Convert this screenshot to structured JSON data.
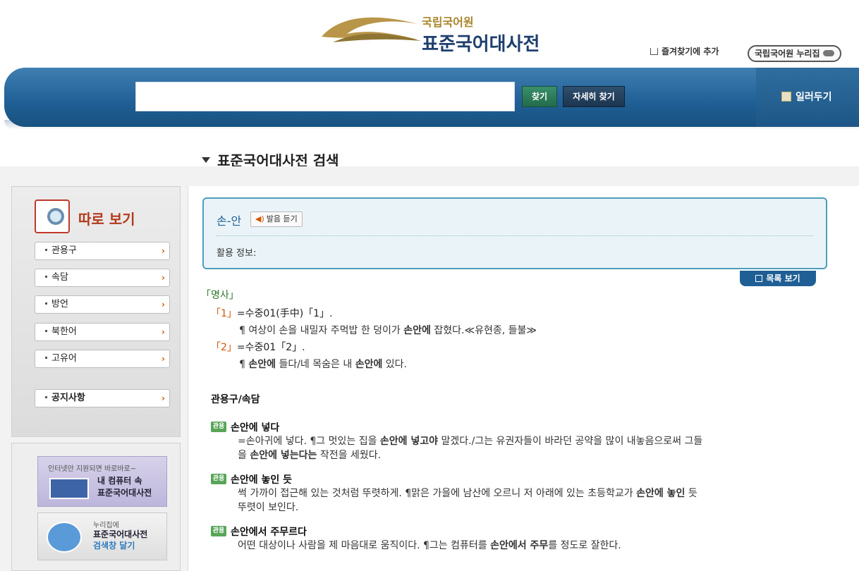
{
  "header": {
    "logo_small": "국립국어원",
    "logo_big": "표준국어대사전",
    "favorite_label": "즐겨찾기에 추가",
    "nuri_label": "국립국어원 누리집"
  },
  "search": {
    "input_value": "",
    "find_label": "찾기",
    "advanced_label": "자세히 찾기",
    "notice_label": "일러두기"
  },
  "page_title": "표준국어대사전 검색",
  "sidebar": {
    "heading": "따로 보기",
    "items": [
      {
        "label": "관용구"
      },
      {
        "label": "속담"
      },
      {
        "label": "방언"
      },
      {
        "label": "북한어"
      },
      {
        "label": "고유어"
      }
    ],
    "notice": "공지사항",
    "arrow": "›"
  },
  "promo": {
    "p1_small": "인터넷만 지원되면 바로바로~",
    "p1_line1": "내 컴퓨터 속",
    "p1_line2": "표준국어대사전",
    "p2_small": "누리집에",
    "p2_line1": "표준국어대사전",
    "p2_line2": "검색창 달기"
  },
  "entry": {
    "word": "손-안",
    "pron_label": "발음 듣기",
    "usage_label": "활용 정보:",
    "list_label": "목록 보기",
    "pos": "「명사」",
    "senses": [
      {
        "num": "「1」",
        "text": "=수중01(手中)「1」.",
        "example_pre": "¶ 여상이 손을 내밀자 주먹밥 한 덩이가 ",
        "example_bold": "손안에",
        "example_post": " 잡혔다.≪유현종, 들불≫"
      },
      {
        "num": "「2」",
        "text": "=수중01「2」.",
        "example_pre": "¶ ",
        "example_bold": "손안에",
        "example_mid": " 들다/네 목숨은 내 ",
        "example_bold2": "손안에",
        "example_post": " 있다."
      }
    ],
    "section_title": "관용구/속담",
    "idiom_badge": "관용",
    "idioms": [
      {
        "title": "손안에 넣다",
        "def_l1_pre": "=손아귀에 넣다. ¶그 멋있는 집을 ",
        "def_l1_bold": "손안에 넣고야",
        "def_l1_post": " 말겠다./그는 유권자들이 바라던 공약을 많이 내놓음으로써 그들",
        "def_l2_pre": "을 ",
        "def_l2_bold": "손안에 넣는다는",
        "def_l2_post": " 작전을 세웠다."
      },
      {
        "title": "손안에 놓인 듯",
        "def_l1_pre": "썩 가까이 접근해 있는 것처럼 뚜렷하게. ¶맑은 가을에 남산에 오르니 저 아래에 있는 초등학교가 ",
        "def_l1_bold": "손안에 놓인",
        "def_l1_post": " 듯",
        "def_l2_pre": "뚜렷이 보인다.",
        "def_l2_bold": "",
        "def_l2_post": ""
      },
      {
        "title": "손안에서 주무르다",
        "def_l1_pre": "어떤 대상이나 사람을 제 마음대로 움직이다. ¶그는 컴퓨터를 ",
        "def_l1_bold": "손안에서 주무",
        "def_l1_post": "를 정도로 잘한다.",
        "def_l2_pre": "",
        "def_l2_bold": "",
        "def_l2_post": ""
      }
    ]
  }
}
